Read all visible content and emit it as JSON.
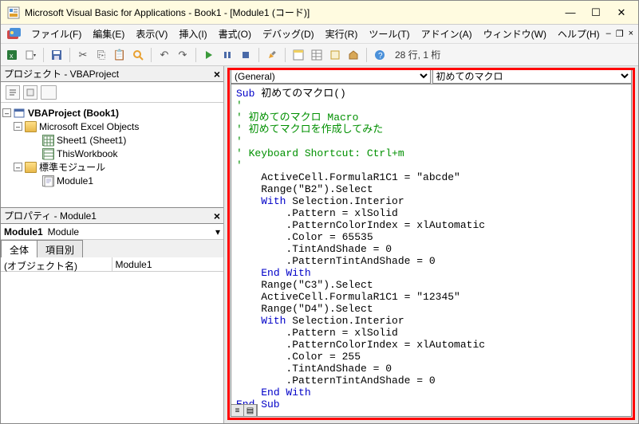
{
  "window": {
    "title": "Microsoft Visual Basic for Applications - Book1 - [Module1 (コード)]"
  },
  "menu": {
    "file": "ファイル(F)",
    "edit": "編集(E)",
    "view": "表示(V)",
    "insert": "挿入(I)",
    "format": "書式(O)",
    "debug": "デバッグ(D)",
    "run": "実行(R)",
    "tools": "ツール(T)",
    "addins": "アドイン(A)",
    "window": "ウィンドウ(W)",
    "help": "ヘルプ(H)"
  },
  "toolbar": {
    "status": "28 行, 1 桁"
  },
  "project_panel": {
    "title": "プロジェクト - VBAProject",
    "root": "VBAProject (Book1)",
    "folder_objects": "Microsoft Excel Objects",
    "sheet1": "Sheet1 (Sheet1)",
    "thiswb": "ThisWorkbook",
    "folder_modules": "標準モジュール",
    "module1": "Module1"
  },
  "props_panel": {
    "title": "プロパティ - Module1",
    "obj_name": "Module1",
    "obj_type": "Module",
    "tab_all": "全体",
    "tab_cat": "項目別",
    "row1_k": "(オブジェクト名)",
    "row1_v": "Module1"
  },
  "code_header": {
    "left": "(General)",
    "right": "初めてのマクロ"
  },
  "code": {
    "l1a": "Sub",
    "l1b": " 初めてのマクロ()",
    "l2": "'",
    "l3": "' 初めてのマクロ Macro",
    "l4": "' 初めてマクロを作成してみた",
    "l5": "'",
    "l6": "' Keyboard Shortcut: Ctrl+m",
    "l7": "'",
    "l8": "    ActiveCell.FormulaR1C1 = \"abcde\"",
    "l9": "    Range(\"B2\").Select",
    "l10a": "    ",
    "l10b": "With",
    "l10c": " Selection.Interior",
    "l11": "        .Pattern = xlSolid",
    "l12": "        .PatternColorIndex = xlAutomatic",
    "l13": "        .Color = 65535",
    "l14": "        .TintAndShade = 0",
    "l15": "        .PatternTintAndShade = 0",
    "l16a": "    ",
    "l16b": "End With",
    "l17": "    Range(\"C3\").Select",
    "l18": "    ActiveCell.FormulaR1C1 = \"12345\"",
    "l19": "    Range(\"D4\").Select",
    "l20a": "    ",
    "l20b": "With",
    "l20c": " Selection.Interior",
    "l21": "        .Pattern = xlSolid",
    "l22": "        .PatternColorIndex = xlAutomatic",
    "l23": "        .Color = 255",
    "l24": "        .TintAndShade = 0",
    "l25": "        .PatternTintAndShade = 0",
    "l26a": "    ",
    "l26b": "End With",
    "l27": "End Sub"
  }
}
